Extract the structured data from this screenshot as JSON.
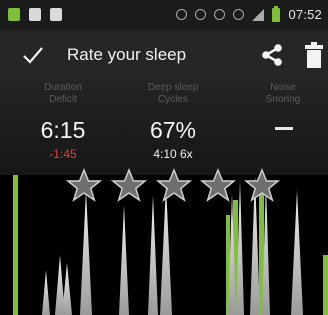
{
  "status_bar": {
    "time": "07:52"
  },
  "header": {
    "title": "Rate your sleep"
  },
  "stats": [
    {
      "label_line1": "Duration",
      "label_line2": "Deficit",
      "main": "6:15",
      "sub": "-1:45",
      "sub_color": "#e0413a"
    },
    {
      "label_line1": "Deep sleep",
      "label_line2": "Cycles",
      "main": "67%",
      "sub": "4:10 6x",
      "sub_color": "#f0f0f0"
    },
    {
      "label_line1": "Noise",
      "label_line2": "Snoring",
      "main": "",
      "sub": "",
      "sub_color": "#f0f0f0"
    }
  ],
  "rating": {
    "stars_total": 5,
    "stars_selected": 0
  },
  "colors": {
    "accent_green": "#7fbf3a",
    "deficit_red": "#e0413a"
  }
}
